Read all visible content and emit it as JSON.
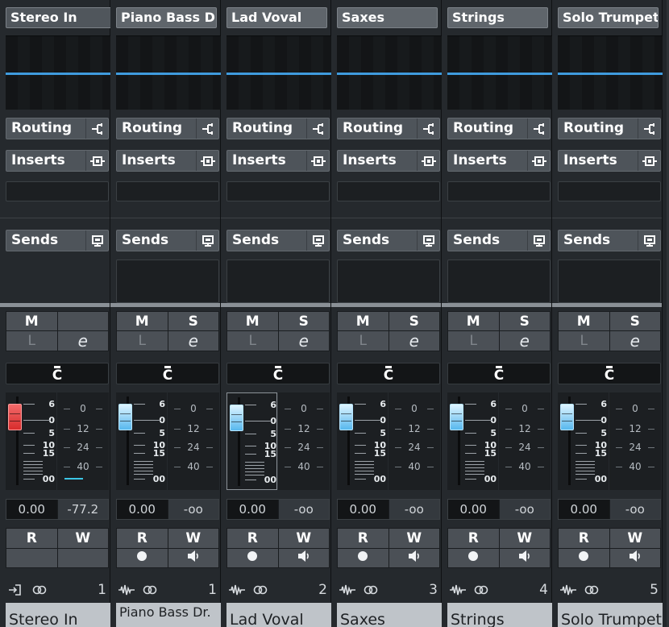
{
  "labels": {
    "routing": "Routing",
    "inserts": "Inserts",
    "sends": "Sends",
    "mute": "M",
    "solo": "S",
    "listen": "L",
    "edit": "e",
    "read": "R",
    "write": "W",
    "pan_center": "C"
  },
  "fader_scale": [
    "6",
    "0",
    "5",
    "10",
    "15",
    "00"
  ],
  "meter_scale": [
    "0",
    "12",
    "24",
    "40"
  ],
  "colors": {
    "line": "#3f9bde",
    "fader_stereo_in": "#d82c2c",
    "fader_channel": "#58b8ee",
    "peak": "#3cc7e6",
    "name_strip": "#bfc4c9"
  },
  "channels": [
    {
      "name": "Stereo In",
      "footer_name": "Stereo In",
      "number": "1",
      "volume": "0.00",
      "peak": "-77.2",
      "kind": "input",
      "footer_icon_a": "input-icon",
      "footer_icon_b": "link-icon"
    },
    {
      "name": "Piano Bass Dr.",
      "footer_name": "Piano Bass Dr.",
      "number": "1",
      "volume": "0.00",
      "peak": "-oo",
      "kind": "audio",
      "footer_icon_a": "waveform-icon",
      "footer_icon_b": "link-icon"
    },
    {
      "name": "Lad Voval",
      "footer_name": "Lad Voval",
      "number": "2",
      "volume": "0.00",
      "peak": "-oo",
      "kind": "audio",
      "footer_icon_a": "waveform-icon",
      "footer_icon_b": "link-icon"
    },
    {
      "name": "Saxes",
      "footer_name": "Saxes",
      "number": "3",
      "volume": "0.00",
      "peak": "-oo",
      "kind": "audio",
      "footer_icon_a": "waveform-icon",
      "footer_icon_b": "link-icon"
    },
    {
      "name": "Strings",
      "footer_name": "Strings",
      "number": "4",
      "volume": "0.00",
      "peak": "-oo",
      "kind": "audio",
      "footer_icon_a": "waveform-icon",
      "footer_icon_b": "link-icon"
    },
    {
      "name": "Solo Trumpet",
      "footer_name": "Solo Trumpet",
      "number": "5",
      "volume": "0.00",
      "peak": "-oo",
      "kind": "audio",
      "footer_icon_a": "waveform-icon",
      "footer_icon_b": "link-icon"
    }
  ]
}
